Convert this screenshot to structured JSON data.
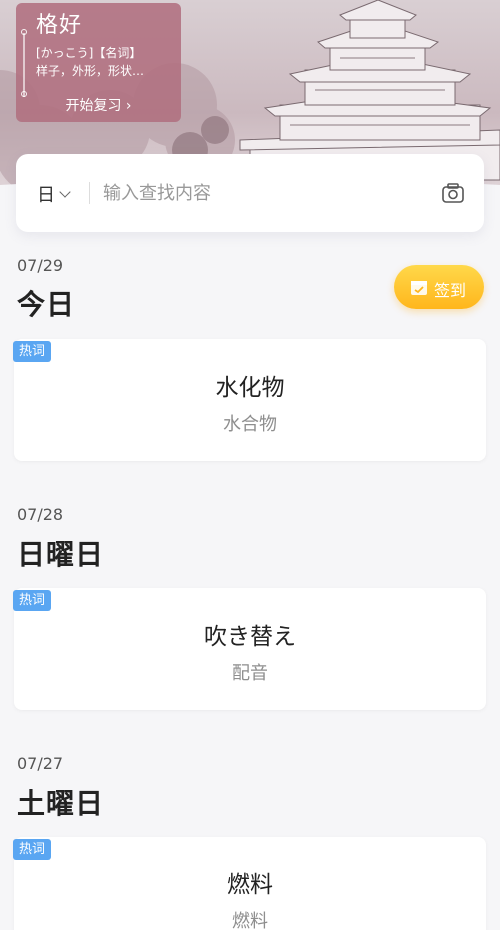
{
  "hero": {
    "word": "格好",
    "reading": "[かっこう]【名词】",
    "meaning": "样子，外形，形状…",
    "review_label": "开始复习 ›"
  },
  "search": {
    "lang": "日",
    "placeholder": "输入查找内容"
  },
  "checkin_label": "签到",
  "days": [
    {
      "date": "07/29",
      "name": "今日",
      "badge": "热词",
      "word": "水化物",
      "meaning": "水合物"
    },
    {
      "date": "07/28",
      "name": "日曜日",
      "badge": "热词",
      "word": "吹き替え",
      "meaning": "配音"
    },
    {
      "date": "07/27",
      "name": "土曜日",
      "badge": "热词",
      "word": "燃料",
      "meaning": "燃料"
    }
  ]
}
